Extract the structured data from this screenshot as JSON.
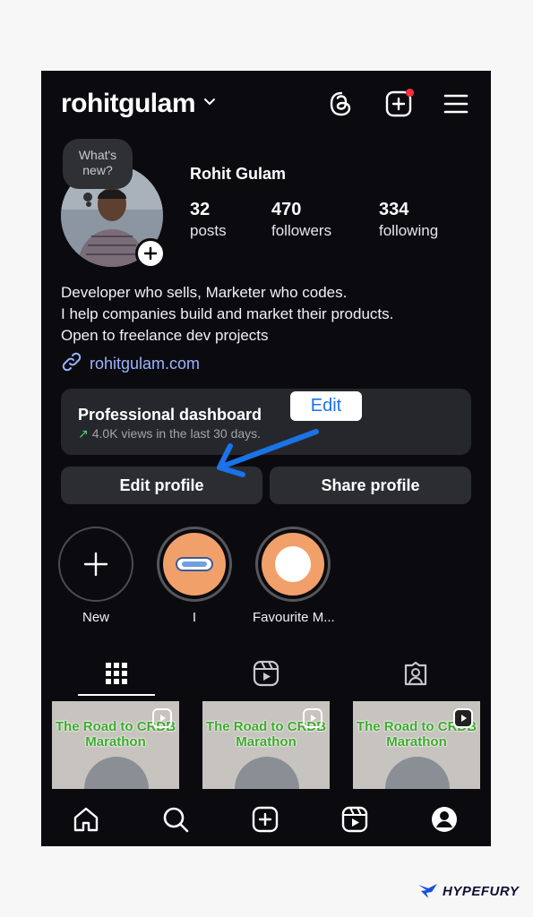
{
  "header": {
    "username": "rohitgulam",
    "icons": [
      "chevron-down-icon",
      "threads-icon",
      "create-post-icon",
      "menu-icon"
    ]
  },
  "profile": {
    "bubble_text": "What's new?",
    "full_name": "Rohit Gulam",
    "stats": [
      {
        "num": "32",
        "label": "posts"
      },
      {
        "num": "470",
        "label": "followers"
      },
      {
        "num": "334",
        "label": "following"
      }
    ],
    "bio": [
      "Developer who sells, Marketer who codes.",
      "I help companies build and market their products.",
      "Open to freelance dev projects"
    ],
    "link": "rohitgulam.com"
  },
  "dashboard": {
    "title": "Professional dashboard",
    "subtitle": "4.0K views in the last 30 days.",
    "edit_tag": "Edit"
  },
  "buttons": {
    "edit_profile": "Edit profile",
    "share_profile": "Share profile"
  },
  "highlights": [
    {
      "label": "New"
    },
    {
      "label": "I"
    },
    {
      "label": "Favourite M..."
    }
  ],
  "posts": [
    {
      "title": "The Road to CRDB Marathon"
    },
    {
      "title": "The Road to CRDB Marathon"
    },
    {
      "title": "The Road to CRDB Marathon"
    }
  ],
  "brand": {
    "name": "HYPEFURY"
  },
  "colors": {
    "accent": "#1a73e8",
    "link": "#9bb4ff",
    "notif": "#ff2d3f",
    "highlight": "#f2a06a",
    "post_title": "#3daa2e"
  }
}
